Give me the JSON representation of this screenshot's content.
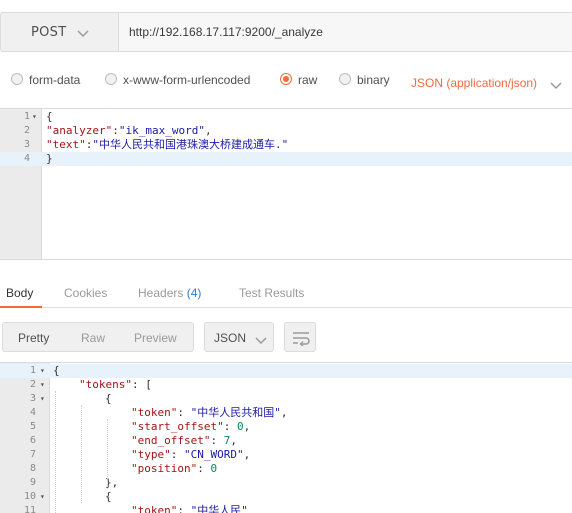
{
  "request": {
    "method": "POST",
    "url": "http://192.168.17.117:9200/_analyze"
  },
  "body_types": [
    {
      "label": "form-data",
      "checked": false
    },
    {
      "label": "x-www-form-urlencoded",
      "checked": false
    },
    {
      "label": "raw",
      "checked": true
    },
    {
      "label": "binary",
      "checked": false
    }
  ],
  "content_type": "JSON (application/json)",
  "request_editor": {
    "lines": [
      {
        "num": "1",
        "fold": true,
        "tokens": [
          {
            "t": "{",
            "c": "c-brace"
          }
        ]
      },
      {
        "num": "2",
        "fold": false,
        "tokens": [
          {
            "t": "\"analyzer\"",
            "c": "c-key"
          },
          {
            "t": ":",
            "c": "c-plain"
          },
          {
            "t": "\"ik_max_word\"",
            "c": "c-str"
          },
          {
            "t": ",",
            "c": "c-plain"
          }
        ]
      },
      {
        "num": "3",
        "fold": false,
        "tokens": [
          {
            "t": "\"text\"",
            "c": "c-key"
          },
          {
            "t": ":",
            "c": "c-plain"
          },
          {
            "t": "\"中华人民共和国港珠澳大桥建成通车.\"",
            "c": "c-str"
          }
        ]
      },
      {
        "num": "4",
        "fold": false,
        "active": true,
        "tokens": [
          {
            "t": "}",
            "c": "c-brace"
          }
        ]
      }
    ]
  },
  "response_tabs": [
    {
      "label": "Body",
      "active": true
    },
    {
      "label": "Cookies",
      "active": false
    },
    {
      "label": "Headers",
      "count": "(4)",
      "active": false
    },
    {
      "label": "Test Results",
      "active": false
    }
  ],
  "view_modes": [
    {
      "label": "Pretty",
      "active": true
    },
    {
      "label": "Raw",
      "active": false
    },
    {
      "label": "Preview",
      "active": false
    }
  ],
  "response_format": "JSON",
  "response_editor": {
    "lines": [
      {
        "num": "1",
        "fold": true,
        "active": true,
        "indent": 0,
        "tokens": [
          {
            "t": "{",
            "c": "c-brace"
          }
        ]
      },
      {
        "num": "2",
        "fold": true,
        "indent": 1,
        "tokens": [
          {
            "t": "\"tokens\"",
            "c": "c-key"
          },
          {
            "t": ": [",
            "c": "c-plain"
          }
        ]
      },
      {
        "num": "3",
        "fold": true,
        "indent": 2,
        "tokens": [
          {
            "t": "{",
            "c": "c-brace"
          }
        ]
      },
      {
        "num": "4",
        "fold": false,
        "indent": 3,
        "tokens": [
          {
            "t": "\"token\"",
            "c": "c-key"
          },
          {
            "t": ": ",
            "c": "c-plain"
          },
          {
            "t": "\"中华人民共和国\"",
            "c": "c-str"
          },
          {
            "t": ",",
            "c": "c-plain"
          }
        ]
      },
      {
        "num": "5",
        "fold": false,
        "indent": 3,
        "tokens": [
          {
            "t": "\"start_offset\"",
            "c": "c-key"
          },
          {
            "t": ": ",
            "c": "c-plain"
          },
          {
            "t": "0",
            "c": "c-num"
          },
          {
            "t": ",",
            "c": "c-plain"
          }
        ]
      },
      {
        "num": "6",
        "fold": false,
        "indent": 3,
        "tokens": [
          {
            "t": "\"end_offset\"",
            "c": "c-key"
          },
          {
            "t": ": ",
            "c": "c-plain"
          },
          {
            "t": "7",
            "c": "c-num"
          },
          {
            "t": ",",
            "c": "c-plain"
          }
        ]
      },
      {
        "num": "7",
        "fold": false,
        "indent": 3,
        "tokens": [
          {
            "t": "\"type\"",
            "c": "c-key"
          },
          {
            "t": ": ",
            "c": "c-plain"
          },
          {
            "t": "\"CN_WORD\"",
            "c": "c-str"
          },
          {
            "t": ",",
            "c": "c-plain"
          }
        ]
      },
      {
        "num": "8",
        "fold": false,
        "indent": 3,
        "tokens": [
          {
            "t": "\"position\"",
            "c": "c-key"
          },
          {
            "t": ": ",
            "c": "c-plain"
          },
          {
            "t": "0",
            "c": "c-num"
          }
        ]
      },
      {
        "num": "9",
        "fold": false,
        "indent": 2,
        "tokens": [
          {
            "t": "},",
            "c": "c-brace"
          }
        ]
      },
      {
        "num": "10",
        "fold": true,
        "indent": 2,
        "tokens": [
          {
            "t": "{",
            "c": "c-brace"
          }
        ]
      },
      {
        "num": "11",
        "fold": false,
        "indent": 3,
        "tokens": [
          {
            "t": "\"token\"",
            "c": "c-key"
          },
          {
            "t": ": ",
            "c": "c-plain"
          },
          {
            "t": "\"中华人民\"",
            "c": "c-str"
          }
        ]
      }
    ]
  },
  "colors": {
    "accent": "#f26b3a",
    "count": "#2a7fd4",
    "json_key": "#a31515",
    "json_string": "#1a1aa6",
    "json_number": "#09885a",
    "active_line": "#e8f2fb"
  },
  "icons": {
    "method_dropdown": "chevron-down-icon",
    "content_type_dropdown": "chevron-down-icon",
    "format_dropdown": "chevron-down-icon",
    "wrap": "wrap-lines-icon",
    "fold": "fold-arrow-icon"
  }
}
